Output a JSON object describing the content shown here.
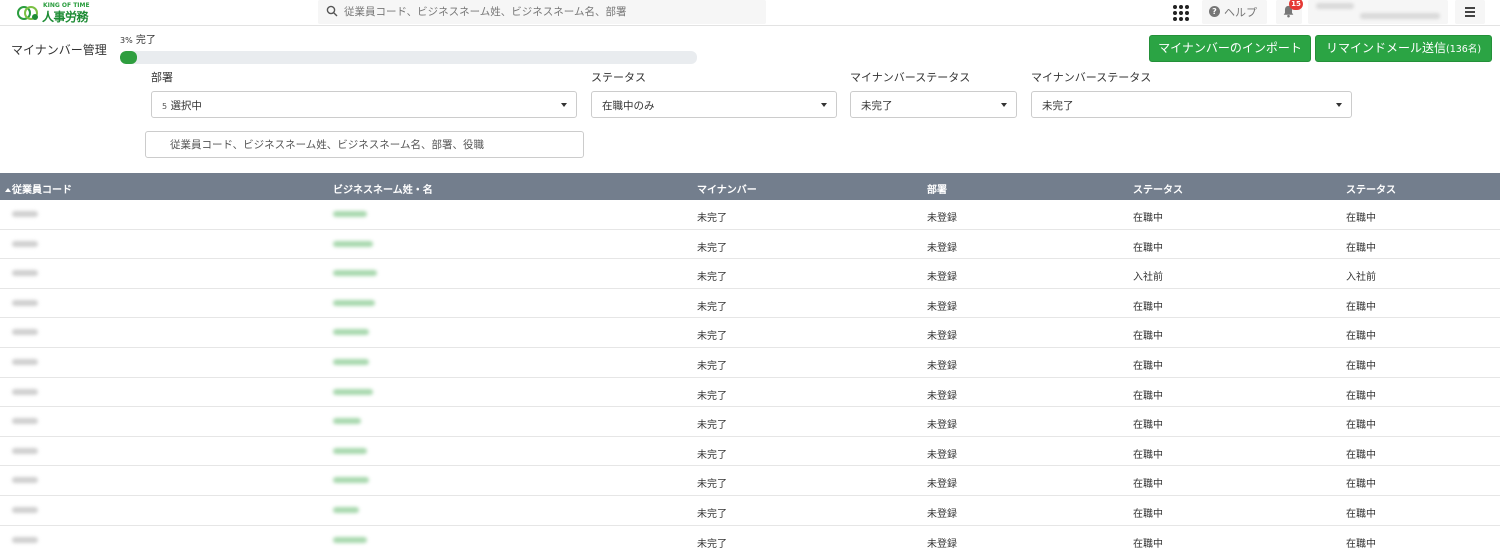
{
  "header": {
    "logo": {
      "sub": "KING OF TIME",
      "main": "人事労務"
    },
    "search_placeholder": "従業員コード、ビジネスネーム姓、ビジネスネーム名、部署",
    "help_label": "ヘルプ",
    "notification_count": "15"
  },
  "page": {
    "title": "マイナンバー管理",
    "progress": {
      "percent_label": "3%",
      "suffix": "完了",
      "value": 0.03
    },
    "buttons": {
      "import": "マイナンバーのインポート",
      "remind": "リマインドメール送信",
      "remind_count": "(136名)"
    }
  },
  "filters": {
    "department": {
      "label": "部署",
      "count": "5",
      "value": "選択中"
    },
    "status": {
      "label": "ステータス",
      "value": "在職中のみ"
    },
    "mynumber_status": {
      "label": "マイナンバーステータス",
      "value": "未完了"
    },
    "mynumber_status2": {
      "label": "マイナンバーステータス",
      "value": "未完了"
    },
    "search_placeholder": "従業員コード、ビジネスネーム姓、ビジネスネーム名、部署、役職"
  },
  "table": {
    "columns": [
      "従業員コード",
      "ビジネスネーム姓・名",
      "マイナンバー",
      "部署",
      "ステータス",
      "ステータス"
    ],
    "rows": [
      {
        "mynumber": "未完了",
        "dept": "未登録",
        "status": "在職中",
        "status2": "在職中"
      },
      {
        "mynumber": "未完了",
        "dept": "未登録",
        "status": "在職中",
        "status2": "在職中"
      },
      {
        "mynumber": "未完了",
        "dept": "未登録",
        "status": "入社前",
        "status2": "入社前"
      },
      {
        "mynumber": "未完了",
        "dept": "未登録",
        "status": "在職中",
        "status2": "在職中"
      },
      {
        "mynumber": "未完了",
        "dept": "未登録",
        "status": "在職中",
        "status2": "在職中"
      },
      {
        "mynumber": "未完了",
        "dept": "未登録",
        "status": "在職中",
        "status2": "在職中"
      },
      {
        "mynumber": "未完了",
        "dept": "未登録",
        "status": "在職中",
        "status2": "在職中"
      },
      {
        "mynumber": "未完了",
        "dept": "未登録",
        "status": "在職中",
        "status2": "在職中"
      },
      {
        "mynumber": "未完了",
        "dept": "未登録",
        "status": "在職中",
        "status2": "在職中"
      },
      {
        "mynumber": "未完了",
        "dept": "未登録",
        "status": "在職中",
        "status2": "在職中"
      },
      {
        "mynumber": "未完了",
        "dept": "未登録",
        "status": "在職中",
        "status2": "在職中"
      },
      {
        "mynumber": "未完了",
        "dept": "未登録",
        "status": "在職中",
        "status2": "在職中"
      }
    ]
  },
  "colors": {
    "accent": "#2ba444",
    "header_row": "#737e8d",
    "badge": "#e53935"
  },
  "icons": [
    "logo-mark-icon",
    "search-icon",
    "apps-grid-icon",
    "help-icon",
    "bell-icon",
    "hamburger-menu-icon",
    "caret-down-icon",
    "sort-asc-icon"
  ]
}
